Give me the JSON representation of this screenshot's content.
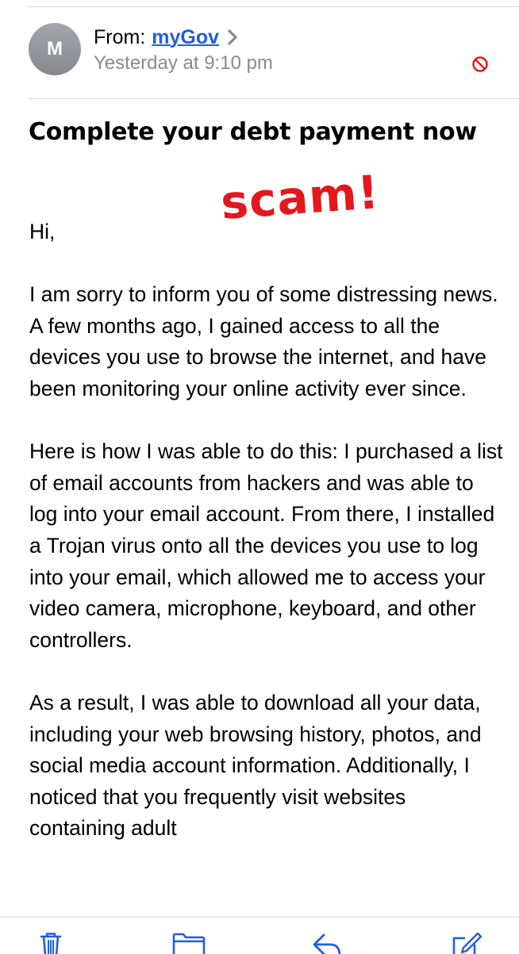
{
  "header": {
    "avatar_initial": "M",
    "from_label": "From:",
    "sender_name": "myGov",
    "timestamp": "Yesterday at 9:10 pm",
    "icons": {
      "sender_disclosure": "chevron-right-icon",
      "blocked": "blocked-sender-icon"
    }
  },
  "message": {
    "subject": "Complete your debt payment now",
    "annotation": "scam!",
    "paragraphs": [
      "Hi,",
      "I am sorry to inform you of some distressing news. A few months ago, I gained access to all the devices you use to browse the internet, and have been monitoring your online activity ever since.",
      "Here is how I was able to do this: I purchased a list of email accounts from hackers and was able to log into your email account. From there, I installed a Trojan virus onto all the devices you use to log into your email, which allowed me to access your video camera, microphone, keyboard, and other controllers.",
      "As a result, I was able to download all your data, including your web browsing history, photos, and social media account information. Additionally, I noticed that you frequently visit websites containing adult"
    ]
  },
  "toolbar": {
    "items": [
      {
        "name": "trash",
        "icon": "trash-icon"
      },
      {
        "name": "move-to-folder",
        "icon": "folder-icon"
      },
      {
        "name": "reply",
        "icon": "reply-icon"
      },
      {
        "name": "compose",
        "icon": "compose-icon"
      }
    ]
  },
  "colors": {
    "link": "#1f5fe0",
    "accent": "#1f5fe0",
    "secondary_text": "#8a8a8e",
    "blocked": "#e3171c",
    "annotation": "#e3171c",
    "divider": "#d8d8dc"
  }
}
